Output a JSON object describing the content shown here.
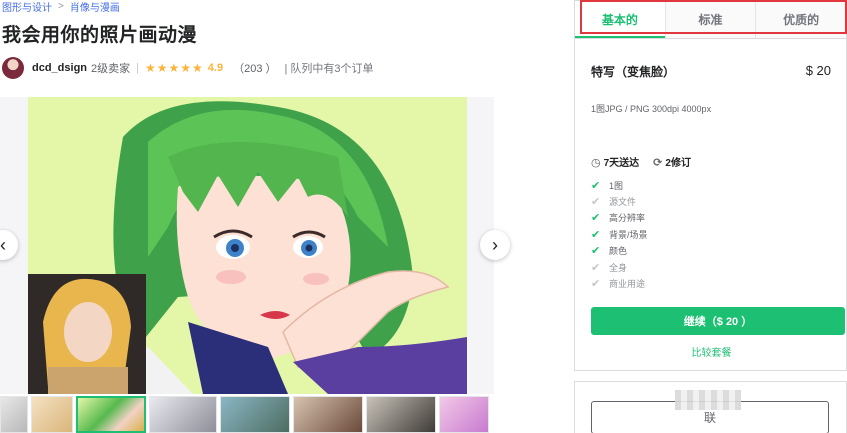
{
  "breadcrumb": {
    "items": [
      "图形与设计",
      "肖像与漫画"
    ],
    "separator": ">"
  },
  "gig": {
    "title": "我会用你的照片画动漫"
  },
  "seller": {
    "name": "dcd_dsign",
    "level": "2级卖家",
    "stars": "★★★★★",
    "rating": "4.9",
    "reviews": "（203 ）",
    "queue": "| 队列中有3个订单"
  },
  "gallery": {
    "prev_icon": "‹",
    "next_icon": "›"
  },
  "packages": {
    "tabs": [
      {
        "label": "基本的",
        "active": true
      },
      {
        "label": "标准",
        "active": false
      },
      {
        "label": "优质的",
        "active": false
      }
    ],
    "selected": {
      "name": "特写（变焦脸）",
      "price": "$ 20",
      "description": "1图JPG / PNG 300dpi 4000px",
      "delivery": "7天送达",
      "revisions": "2修订",
      "features": [
        {
          "label": "1图",
          "included": true
        },
        {
          "label": "源文件",
          "included": false
        },
        {
          "label": "高分辨率",
          "included": true
        },
        {
          "label": "背景/场景",
          "included": true
        },
        {
          "label": "颜色",
          "included": true
        },
        {
          "label": "全身",
          "included": false
        },
        {
          "label": "商业用途",
          "included": false
        }
      ],
      "continue_label": "继续（$ 20 ）",
      "compare_label": "比较套餐"
    }
  },
  "contact": {
    "button_label": "联"
  },
  "colors": {
    "accent": "#1dbf73",
    "star": "#ffb33e",
    "highlight": "#e0383e"
  }
}
